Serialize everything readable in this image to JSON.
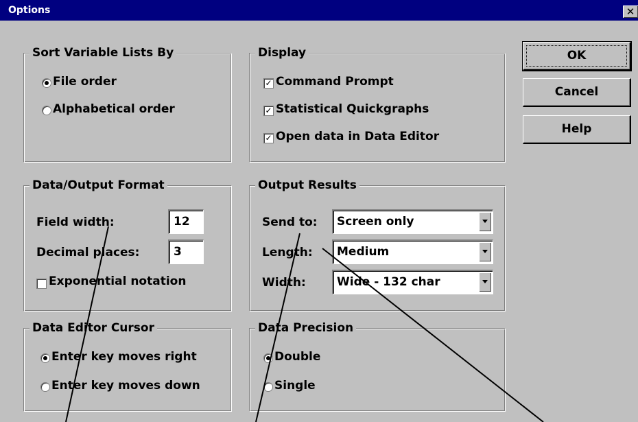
{
  "window": {
    "title": "Options",
    "close_glyph": "✕"
  },
  "sort": {
    "legend": "Sort Variable Lists By",
    "options": [
      {
        "label": "File order",
        "selected": true
      },
      {
        "label": "Alphabetical order",
        "selected": false
      }
    ]
  },
  "display": {
    "legend": "Display",
    "items": [
      {
        "label": "Command Prompt",
        "checked": true
      },
      {
        "label": "Statistical Quickgraphs",
        "checked": true
      },
      {
        "label": "Open data in Data Editor",
        "checked": true
      }
    ]
  },
  "format": {
    "legend": "Data/Output Format",
    "field_width_label": "Field width:",
    "field_width_value": "12",
    "decimal_label": "Decimal places:",
    "decimal_value": "3",
    "exponential_label": "Exponential notation",
    "exponential_checked": false
  },
  "output": {
    "legend": "Output Results",
    "send_label": "Send to:",
    "send_value": "Screen only",
    "length_label": "Length:",
    "length_value": "Medium",
    "width_label": "Width:",
    "width_value": "Wide - 132 char"
  },
  "cursor": {
    "legend": "Data Editor Cursor",
    "options": [
      {
        "label": "Enter key moves right",
        "selected": true
      },
      {
        "label": "Enter key moves down",
        "selected": false
      }
    ]
  },
  "precision": {
    "legend": "Data Precision",
    "options": [
      {
        "label": "Double",
        "selected": true
      },
      {
        "label": "Single",
        "selected": false
      }
    ]
  },
  "buttons": {
    "ok": "OK",
    "cancel": "Cancel",
    "help": "Help"
  },
  "checkmark_glyph": "✓",
  "icons": {
    "close": "close-icon",
    "radio": "radio-button",
    "checkbox": "checkbox",
    "dropdown": "chevron-down-icon"
  },
  "colors": {
    "titlebar": "#000080",
    "face": "#c0c0c0",
    "annotation_lines": "#000000"
  }
}
